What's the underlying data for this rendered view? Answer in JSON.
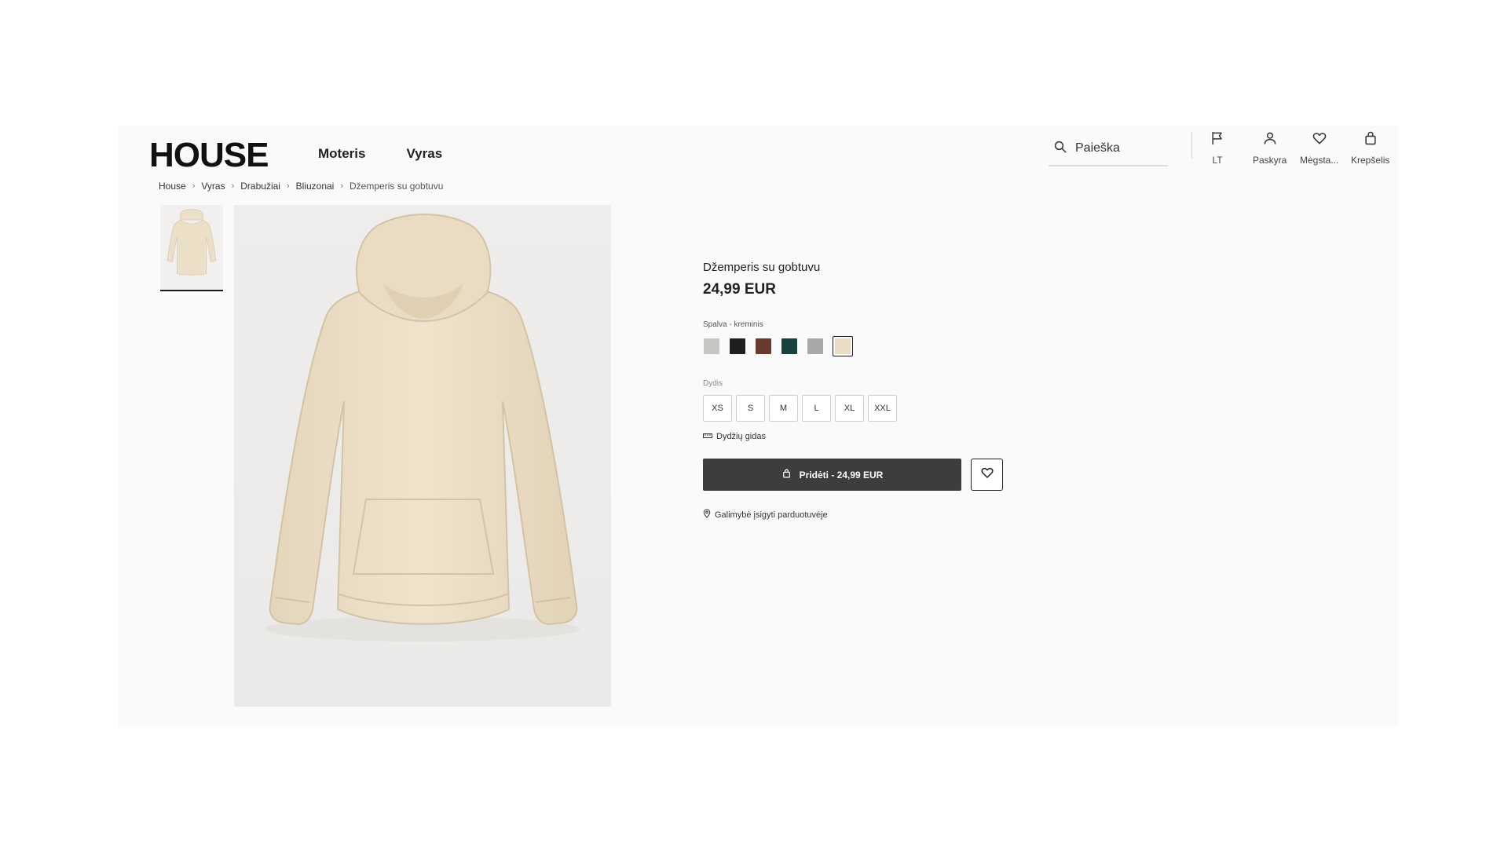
{
  "header": {
    "logo": "HOUSE",
    "nav": [
      "Moteris",
      "Vyras"
    ],
    "search_label": "Paieška",
    "actions": {
      "language": "LT",
      "account": "Paskyra",
      "favorites": "Mėgsta...",
      "cart": "Krepšelis"
    }
  },
  "breadcrumb": [
    "House",
    "Vyras",
    "Drabužiai",
    "Bliuzonai",
    "Džemperis su gobtuvu"
  ],
  "product": {
    "title": "Džemperis su gobtuvu",
    "price": "24,99 EUR",
    "color_label": "Spalva - kreminis",
    "colors": [
      {
        "name": "light-grey",
        "hex": "#c7c6c2"
      },
      {
        "name": "black",
        "hex": "#1f1f1f"
      },
      {
        "name": "brown",
        "hex": "#6b3a2f"
      },
      {
        "name": "dark-teal",
        "hex": "#17423f"
      },
      {
        "name": "grey",
        "hex": "#a8a8aa"
      },
      {
        "name": "cream",
        "hex": "#e9dcc5",
        "selected": true
      }
    ],
    "size_label": "Dydis",
    "sizes": [
      "XS",
      "S",
      "M",
      "L",
      "XL",
      "XXL"
    ],
    "size_guide": "Dydžių gidas",
    "add_to_cart": "Pridėti - 24,99 EUR",
    "store_availability": "Galimybė įsigyti parduotuvėje"
  },
  "colors": {
    "accent": "#3d3d3d",
    "hoodie": "#ecdfc7"
  }
}
